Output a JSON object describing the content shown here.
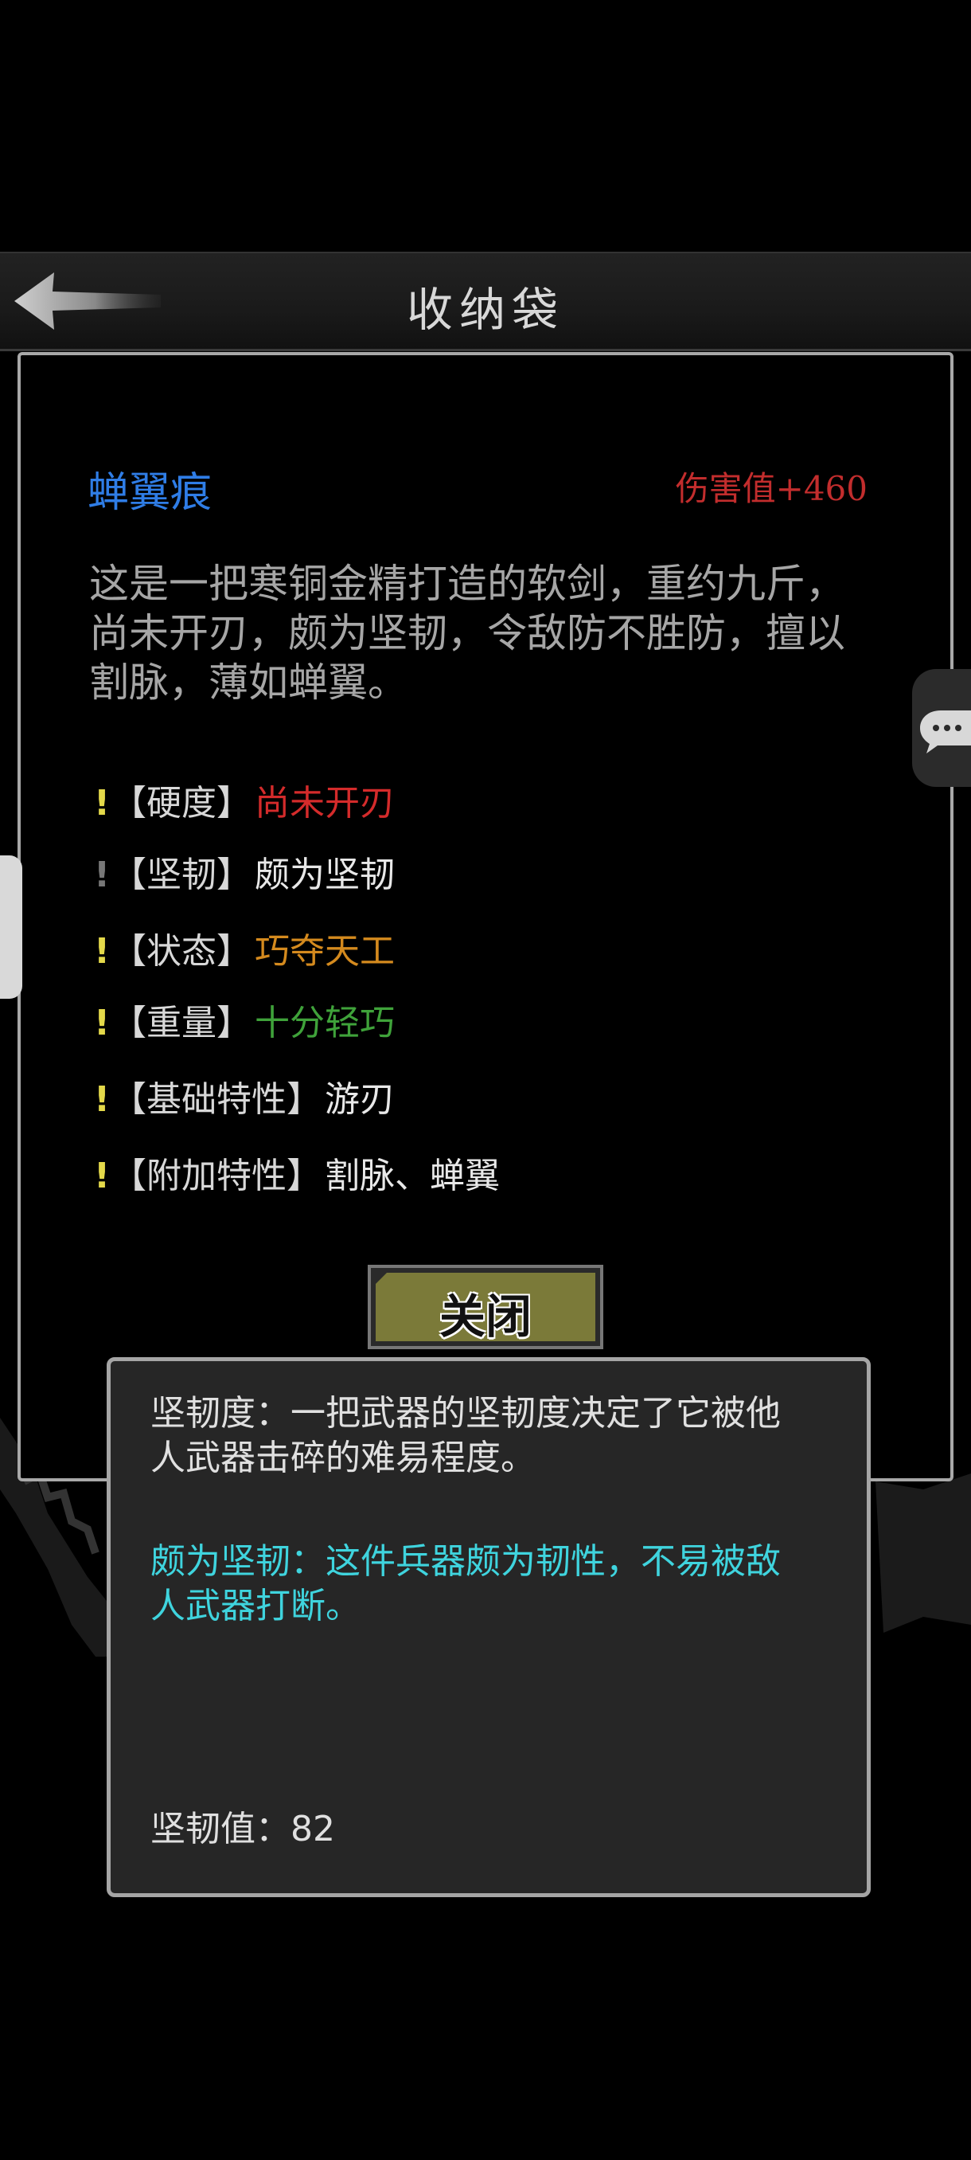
{
  "titlebar": {
    "title": "收纳袋"
  },
  "item": {
    "name": "蝉翼痕",
    "damage": "伤害值+460",
    "description": "这是一把寒铜金精打造的软剑，重约九斤，\n尚未开刃，颇为坚韧，令敌防不胜防，擅以\n割脉，薄如蝉翼。",
    "attributes": [
      {
        "mark": "!",
        "key": "【硬度】",
        "value": "尚未开刃",
        "color": "#d42b2b"
      },
      {
        "mark": "!",
        "key": "【坚韧】",
        "value": "颇为坚韧",
        "color": "#e8e8e8"
      },
      {
        "mark": "!",
        "key": "【状态】",
        "value": "巧夺天工",
        "color": "#d48a1e"
      },
      {
        "mark": "!",
        "key": "【重量】",
        "value": "十分轻巧",
        "color": "#3fa23a"
      },
      {
        "mark": "!",
        "key": "【基础特性】",
        "value": "游刃",
        "color": "#e8e8e8"
      },
      {
        "mark": "!",
        "key": "【附加特性】",
        "value": "割脉、蝉翼",
        "color": "#e8e8e8"
      }
    ]
  },
  "close_button": {
    "label": "关闭"
  },
  "tooltip": {
    "definition": "坚韧度：一把武器的坚韧度决定了它被他\n人武器击碎的难易程度。",
    "effect": "颇为坚韧：这件兵器颇为韧性，不易被敌\n人武器打断。",
    "value_text": "坚韧值：82"
  },
  "icons": {
    "back": "back-arrow-icon",
    "chat": "chat-bubble-icon"
  },
  "colors": {
    "name_blue": "#2f7de6",
    "damage_red": "#c22d2d",
    "tooltip_cyan": "#3fd4de",
    "mark_yellow": "#e4d94a"
  }
}
